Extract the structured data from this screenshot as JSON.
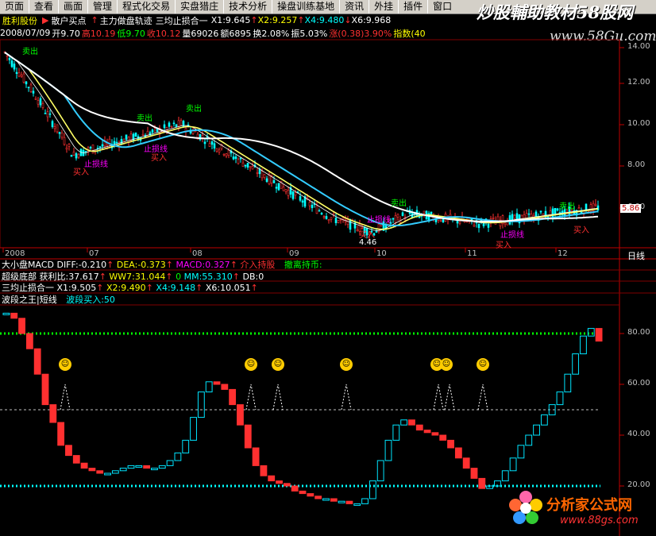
{
  "menu": [
    "页面",
    "查看",
    "画面",
    "管理",
    "程式化交易",
    "实盘猎庄",
    "技术分析",
    "操盘训练基地",
    "资讯",
    "外挂",
    "插件",
    "窗口"
  ],
  "brand": {
    "text": "炒股輔助教材58股网",
    "url": "www.58Gu.com"
  },
  "title": {
    "stock": "胜利股份",
    "item1": "散户买点",
    "item2": "主力做盘轨迹",
    "item3": "三均止损合一",
    "x1": "X1:9.645",
    "x2": "X2:9.257",
    "x4": "X4:9.480",
    "x6": "X6:9.968"
  },
  "quote": {
    "date": "2008/07/09",
    "open": "开9.70",
    "high": "高10.19",
    "low": "低9.70",
    "close": "收10.12",
    "vol": "量69026",
    "amt": "额6895",
    "turn": "换2.08%",
    "amp": "振5.03%",
    "chg": "涨(0.38)3.90%",
    "idx": "指数(40"
  },
  "price_axis": {
    "ticks": [
      "14.00",
      "12.00",
      "10.00",
      "8.00",
      "6.00"
    ],
    "current": "5.86"
  },
  "time_axis": {
    "labels": [
      "2008",
      "07",
      "08",
      "09",
      "10",
      "11",
      "12"
    ],
    "period": "日线"
  },
  "annotations": {
    "buy": "买入",
    "sell": "卖出",
    "stop": "止损线",
    "low_price": "4.46"
  },
  "macd": {
    "line": "大小盘MACD DIFF:-0.210",
    "dea": "DEA:-0.373",
    "macd": "MACD:0.327",
    "s1": "介入持股",
    "s2": "撤离持币:"
  },
  "bottom": {
    "line": "超级底部 获利比:37.617",
    "ww7": "WW7:31.044",
    "zero": "0",
    "mm": "MM:55.310",
    "db": "DB:0"
  },
  "stop": {
    "line": "三均止损合一 X1:9.505",
    "x2": "X2:9.490",
    "x4": "X4:9.148",
    "x6": "X6:10.051"
  },
  "wave": {
    "name": "波段之王|短线",
    "buy": "波段买入:50",
    "ticks": [
      "80.00",
      "60.00",
      "40.00",
      "20.00"
    ]
  },
  "logo": {
    "text": "分析家公式网",
    "url": "www.88gs.com"
  }
}
